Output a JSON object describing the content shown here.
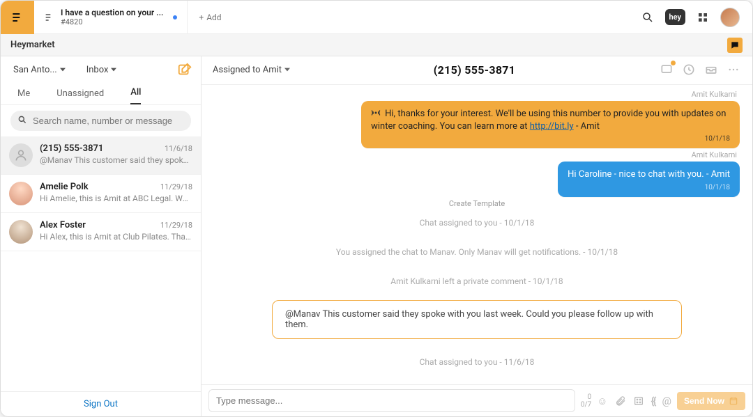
{
  "topbar": {
    "ticket_title": "I have a question on your ...",
    "ticket_id": "#4820",
    "add_label": "Add",
    "hey_badge": "hey"
  },
  "subheader": {
    "title": "Heymarket"
  },
  "sidebar": {
    "location_dropdown": "San Anto...",
    "inbox_dropdown": "Inbox",
    "tabs": {
      "me": "Me",
      "unassigned": "Unassigned",
      "all": "All"
    },
    "search_placeholder": "Search name, number or message",
    "sign_out": "Sign Out",
    "conversations": [
      {
        "name": "(215) 555-3871",
        "date": "11/6/18",
        "preview": "@Manav This customer said they spoke ..."
      },
      {
        "name": "Amelie Polk",
        "date": "11/29/18",
        "preview": "Hi Amelie, this is Amit at ABC Legal. Wa..."
      },
      {
        "name": "Alex Foster",
        "date": "11/29/18",
        "preview": "Hi Alex, this is Amit at Club Pilates. Than..."
      }
    ]
  },
  "chat": {
    "assigned_label": "Assigned to Amit",
    "title": "(215) 555-3871",
    "sender1": "Amit Kulkarni",
    "bubble1_text": "Hi, thanks for your interest. We'll be using this number to provide you with updates on winter coaching. You can learn more at ",
    "bubble1_link": "http://bit.ly",
    "bubble1_suffix": " - Amit",
    "bubble1_date": "10/1/18",
    "sender2": "Amit Kulkarni",
    "bubble2_text": "Hi Caroline - nice to chat with you. - Amit",
    "bubble2_date": "10/1/18",
    "create_template": "Create Template",
    "sys1": "Chat assigned to you -  10/1/18",
    "sys2": "You assigned the chat to Manav. Only Manav will get notifications. -  10/1/18",
    "sys3": "Amit Kulkarni left a private comment - 10/1/18",
    "private_note": "@Manav This customer said they spoke with you last week. Could you please follow up with them.",
    "sys4": "Chat assigned to you -  11/6/18"
  },
  "composer": {
    "placeholder": "Type message...",
    "counter_top": "0",
    "counter_bottom": "0/7",
    "send_label": "Send Now"
  }
}
